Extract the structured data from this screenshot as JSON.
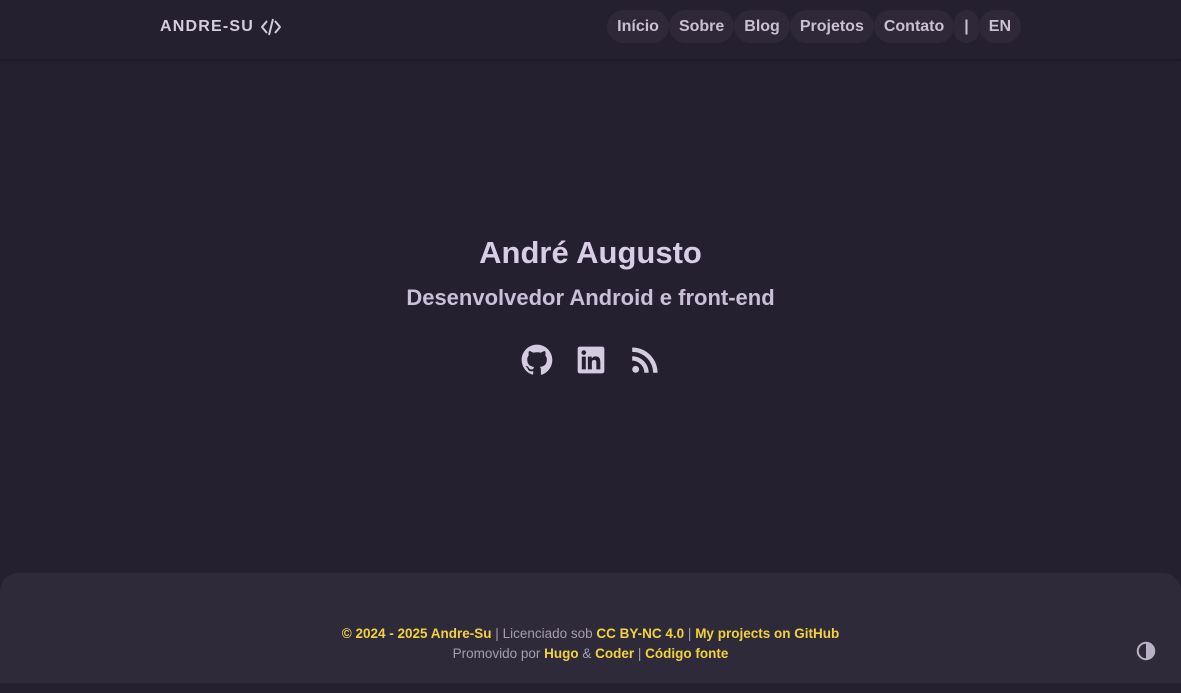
{
  "brand": {
    "name": "ANDRE-SU",
    "icon": "code-icon"
  },
  "nav": {
    "items": [
      {
        "label": "Início"
      },
      {
        "label": "Sobre"
      },
      {
        "label": "Blog"
      },
      {
        "label": "Projetos"
      },
      {
        "label": "Contato"
      }
    ],
    "separator": "|",
    "language": "EN"
  },
  "hero": {
    "name": "André Augusto",
    "subtitle": "Desenvolvedor Android e front-end"
  },
  "social": [
    {
      "icon": "github-icon"
    },
    {
      "icon": "linkedin-icon"
    },
    {
      "icon": "rss-icon"
    }
  ],
  "footer": {
    "copyright": "© 2024 - 2025 Andre-Su",
    "sep1": " | ",
    "licensed_text": "Licenciado sob ",
    "license_link": "CC BY-NC 4.0",
    "sep2": " | ",
    "projects_link": "My projects on GitHub",
    "powered_text": "Promovido por ",
    "hugo_link": "Hugo",
    "amp": " & ",
    "coder_link": "Coder",
    "sep3": " | ",
    "source_link": "Código fonte"
  },
  "theme_toggle": {
    "icon": "contrast-icon"
  },
  "colors": {
    "background": "#25202f",
    "footer_bg": "#2f2a3a",
    "accent": "#f2d23e",
    "text": "#d4cbe0"
  }
}
